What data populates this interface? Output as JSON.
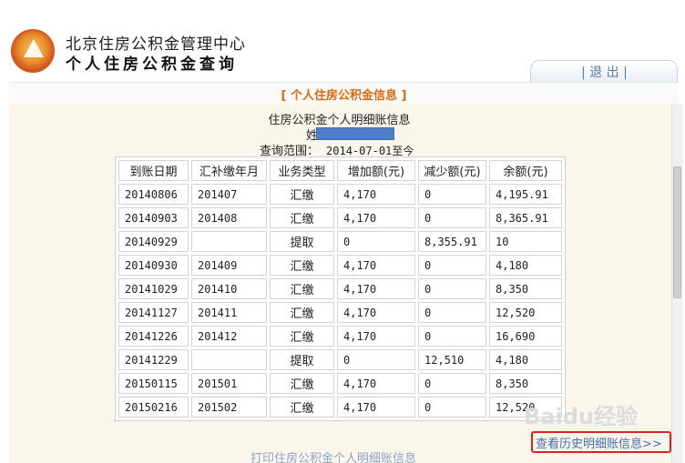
{
  "header": {
    "org_name": "北京住房公积金管理中心",
    "app_name": "个人住房公积金查询",
    "logout_label": "| 退 出 |"
  },
  "section_title": "[ 个人住房公积金信息 ]",
  "info": {
    "title": "住房公积金个人明细账信息",
    "name_label": "姓",
    "range_label": "查询范围：",
    "range_value": "2014-07-01至今"
  },
  "table": {
    "headers": [
      "到账日期",
      "汇补缴年月",
      "业务类型",
      "增加额(元)",
      "减少额(元)",
      "余额(元)"
    ],
    "rows": [
      [
        "20140806",
        "201407",
        "汇缴",
        "4,170",
        "0",
        "4,195.91"
      ],
      [
        "20140903",
        "201408",
        "汇缴",
        "4,170",
        "0",
        "8,365.91"
      ],
      [
        "20140929",
        "",
        "提取",
        "0",
        "8,355.91",
        "10"
      ],
      [
        "20140930",
        "201409",
        "汇缴",
        "4,170",
        "0",
        "4,180"
      ],
      [
        "20141029",
        "201410",
        "汇缴",
        "4,170",
        "0",
        "8,350"
      ],
      [
        "20141127",
        "201411",
        "汇缴",
        "4,170",
        "0",
        "12,520"
      ],
      [
        "20141226",
        "201412",
        "汇缴",
        "4,170",
        "0",
        "16,690"
      ],
      [
        "20141229",
        "",
        "提取",
        "0",
        "12,510",
        "4,180"
      ],
      [
        "20150115",
        "201501",
        "汇缴",
        "4,170",
        "0",
        "8,350"
      ],
      [
        "20150216",
        "201502",
        "汇缴",
        "4,170",
        "0",
        "12,520"
      ]
    ]
  },
  "links": {
    "history": "查看历史明细账信息>>",
    "print": "打印住房公积金个人明细账信息"
  },
  "watermark": "Baidu经验",
  "colors": {
    "accent": "#d86a10",
    "link": "#3f6fb0",
    "highlight_border": "#e02020",
    "panel_bg": "#fbf6ec",
    "name_mask": "#4f7ec6"
  }
}
